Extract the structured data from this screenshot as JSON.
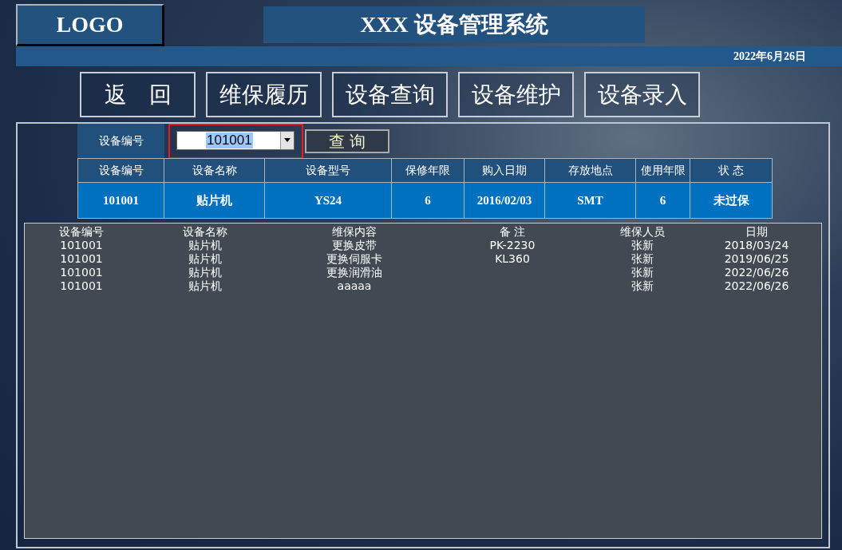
{
  "header": {
    "logo": "LOGO",
    "title": "XXX 设备管理系统",
    "date": "2022年6月26日"
  },
  "nav": [
    {
      "label": "返　回"
    },
    {
      "label": "维保履历"
    },
    {
      "label": "设备查询"
    },
    {
      "label": "设备维护"
    },
    {
      "label": "设备录入"
    }
  ],
  "search": {
    "label": "设备编号",
    "value": "101001",
    "button": "查  询"
  },
  "device_table": {
    "columns": [
      "设备编号",
      "设备名称",
      "设备型号",
      "保修年限",
      "购入日期",
      "存放地点",
      "使用年限",
      "状  态"
    ],
    "rows": [
      [
        "101001",
        "贴片机",
        "YS24",
        "6",
        "2016/02/03",
        "SMT",
        "6",
        "未过保"
      ]
    ]
  },
  "history": {
    "columns": [
      "设备编号",
      "设备名称",
      "维保内容",
      "备 注",
      "维保人员",
      "日期"
    ],
    "rows": [
      [
        "101001",
        "贴片机",
        "更换皮带",
        "PK-2230",
        "张新",
        "2018/03/24"
      ],
      [
        "101001",
        "贴片机",
        "更换伺服卡",
        "KL360",
        "张新",
        "2019/06/25"
      ],
      [
        "101001",
        "贴片机",
        "更换润滑油",
        "",
        "张新",
        "2022/06/26"
      ],
      [
        "101001",
        "贴片机",
        "aaaaa",
        "",
        "张新",
        "2022/06/26"
      ]
    ]
  }
}
